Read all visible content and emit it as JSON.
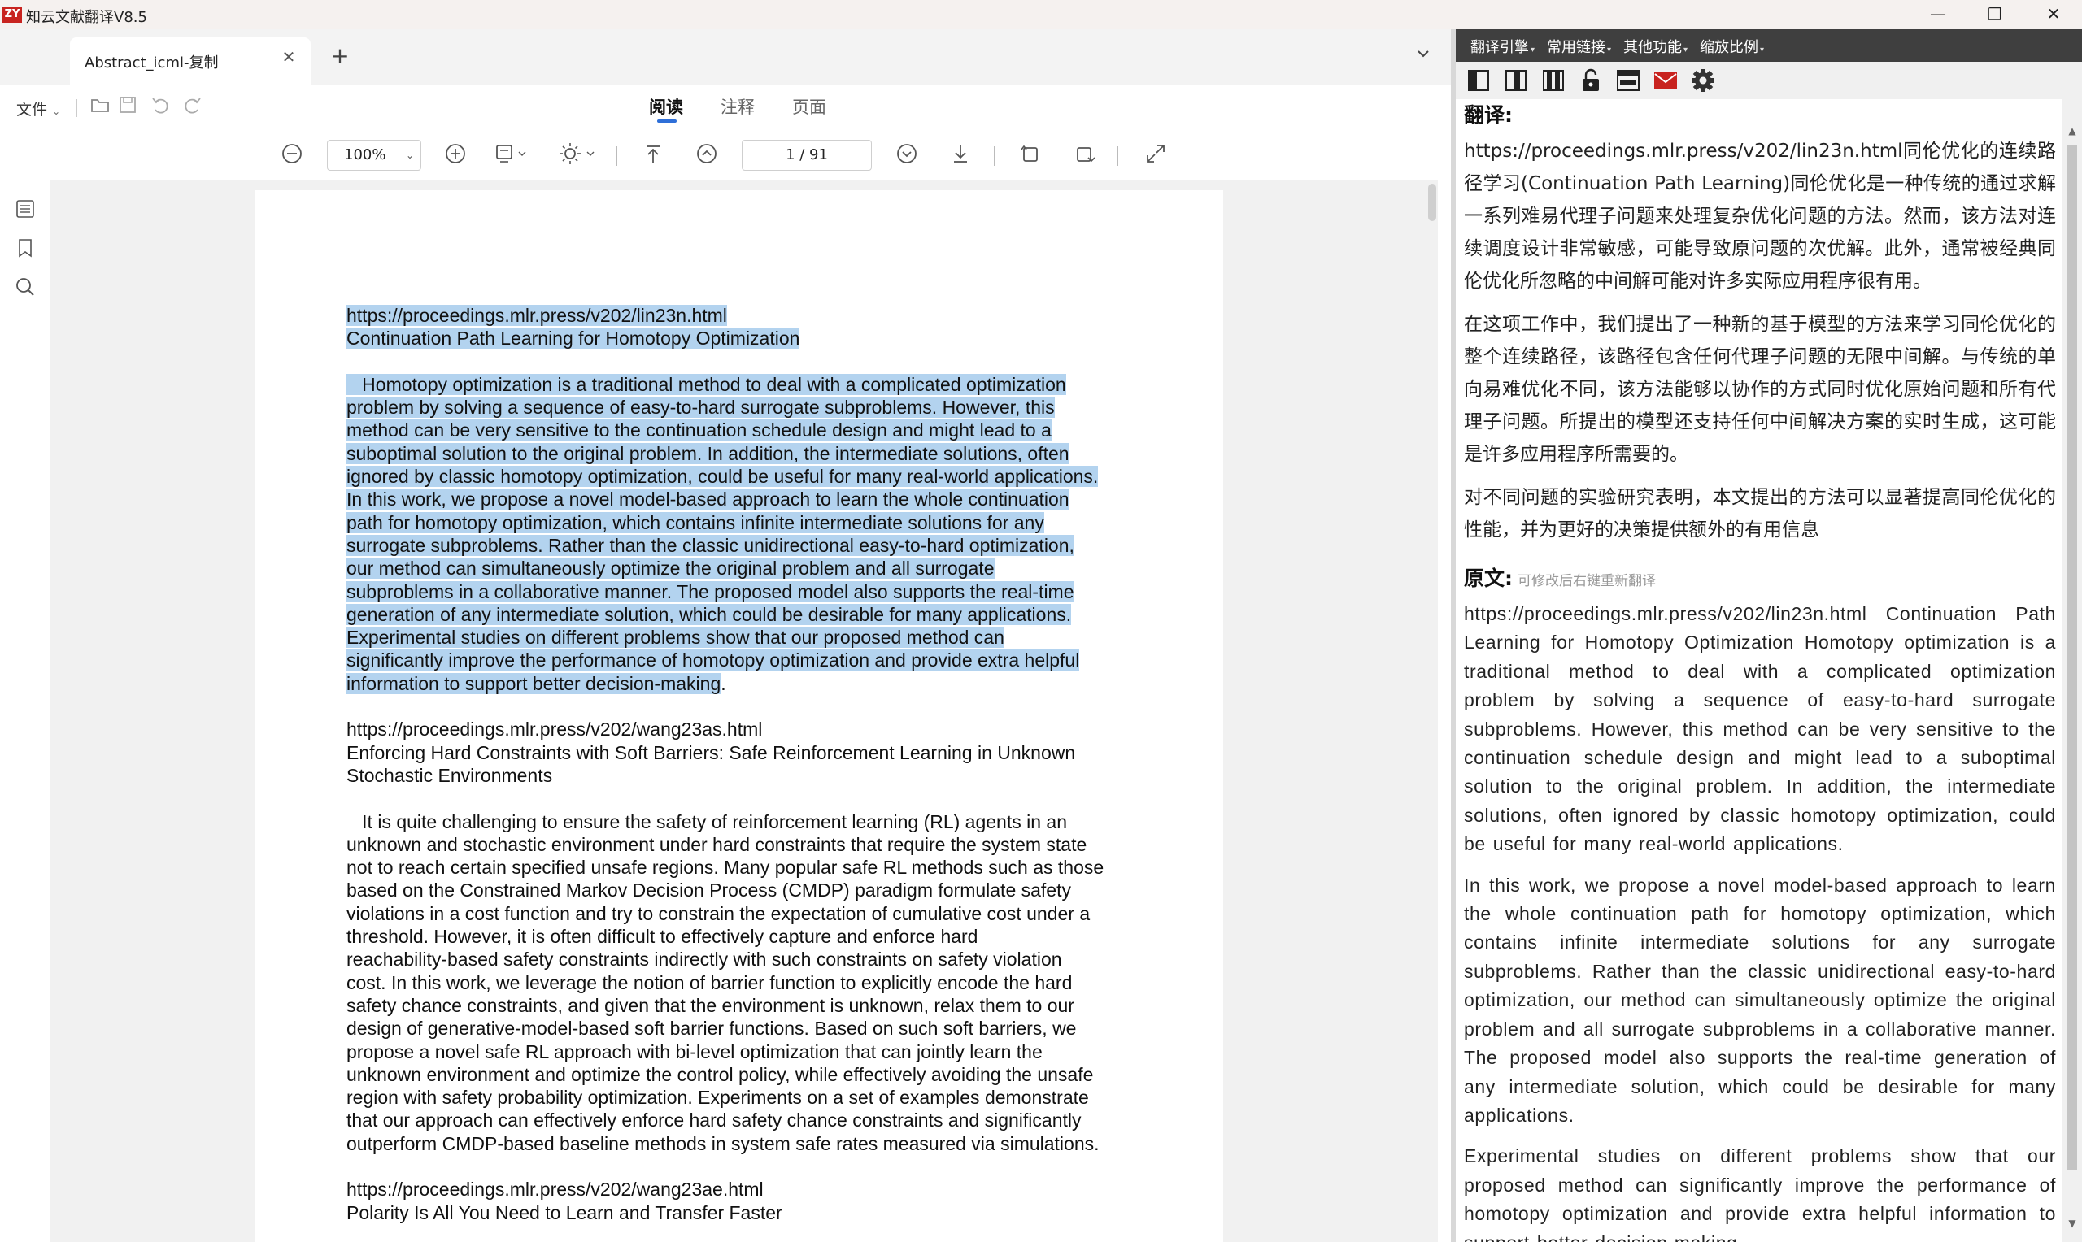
{
  "app": {
    "logo": "ZY",
    "title": "知云文献翻译V8.5",
    "minimize": "—",
    "maximize": "❐",
    "close": "✕"
  },
  "tabs": {
    "items": [
      {
        "label": "Abstract_icml-复制",
        "active": true
      }
    ],
    "new_tab": "+",
    "dropdown": "⌄"
  },
  "toolbar": {
    "file_menu": "文件",
    "modes": [
      "阅读",
      "注释",
      "页面"
    ],
    "active_mode": "阅读",
    "zoom": "100%",
    "page_indicator": "1 / 91"
  },
  "document": {
    "lines": [
      {
        "text": "https://proceedings.mlr.press/v202/lin23n.html",
        "highlighted": true
      },
      {
        "text": "Continuation Path Learning for Homotopy Optimization",
        "highlighted": true
      },
      {
        "text": "",
        "highlighted": false
      },
      {
        "text": "   Homotopy optimization is a traditional method to deal with a complicated optimization",
        "highlighted": true
      },
      {
        "text": "problem by solving a sequence of easy-to-hard surrogate subproblems. However, this",
        "highlighted": true
      },
      {
        "text": "method can be very sensitive to the continuation schedule design and might lead to a",
        "highlighted": true
      },
      {
        "text": "suboptimal solution to the original problem. In addition, the intermediate solutions, often",
        "highlighted": true
      },
      {
        "text": "ignored by classic homotopy optimization, could be useful for many real-world applications.",
        "highlighted": true
      },
      {
        "text": "In this work, we propose a novel model-based approach to learn the whole continuation",
        "highlighted": true
      },
      {
        "text": "path for homotopy optimization, which contains infinite intermediate solutions for any",
        "highlighted": true
      },
      {
        "text": "surrogate subproblems. Rather than the classic unidirectional easy-to-hard optimization,",
        "highlighted": true
      },
      {
        "text": "our method can simultaneously optimize the original problem and all surrogate",
        "highlighted": true
      },
      {
        "text": "subproblems in a collaborative manner. The proposed model also supports the real-time",
        "highlighted": true
      },
      {
        "text": "generation of any intermediate solution, which could be desirable for many applications.",
        "highlighted": true
      },
      {
        "text": "Experimental studies on different problems show that our proposed method can",
        "highlighted": true
      },
      {
        "text": "significantly improve the performance of homotopy optimization and provide extra helpful",
        "highlighted": true
      },
      {
        "text": "information to support better decision-making",
        "highlighted": true,
        "tail": "."
      },
      {
        "text": "",
        "highlighted": false
      },
      {
        "text": "https://proceedings.mlr.press/v202/wang23as.html",
        "highlighted": false
      },
      {
        "text": "Enforcing Hard Constraints with Soft Barriers: Safe Reinforcement Learning in Unknown",
        "highlighted": false
      },
      {
        "text": "Stochastic Environments",
        "highlighted": false
      },
      {
        "text": "",
        "highlighted": false
      },
      {
        "text": "   It is quite challenging to ensure the safety of reinforcement learning (RL) agents in an",
        "highlighted": false
      },
      {
        "text": "unknown and stochastic environment under hard constraints that require the system state",
        "highlighted": false
      },
      {
        "text": "not to reach certain specified unsafe regions. Many popular safe RL methods such as those",
        "highlighted": false
      },
      {
        "text": "based on the Constrained Markov Decision Process (CMDP) paradigm formulate safety",
        "highlighted": false
      },
      {
        "text": "violations in a cost function and try to constrain the expectation of cumulative cost under a",
        "highlighted": false
      },
      {
        "text": "threshold. However, it is often difficult to effectively capture and enforce hard",
        "highlighted": false
      },
      {
        "text": "reachability-based safety constraints indirectly with such constraints on safety violation",
        "highlighted": false
      },
      {
        "text": "cost. In this work, we leverage the notion of barrier function to explicitly encode the hard",
        "highlighted": false
      },
      {
        "text": "safety chance constraints, and given that the environment is unknown, relax them to our",
        "highlighted": false
      },
      {
        "text": "design of generative-model-based soft barrier functions. Based on such soft barriers, we",
        "highlighted": false
      },
      {
        "text": "propose a novel safe RL approach with bi-level optimization that can jointly learn the",
        "highlighted": false
      },
      {
        "text": "unknown environment and optimize the control policy, while effectively avoiding the unsafe",
        "highlighted": false
      },
      {
        "text": "region with safety probability optimization. Experiments on a set of examples demonstrate",
        "highlighted": false
      },
      {
        "text": "that our approach can effectively enforce hard safety chance constraints and significantly",
        "highlighted": false
      },
      {
        "text": "outperform CMDP-based baseline methods in system safe rates measured via simulations.",
        "highlighted": false
      },
      {
        "text": "",
        "highlighted": false
      },
      {
        "text": "https://proceedings.mlr.press/v202/wang23ae.html",
        "highlighted": false
      },
      {
        "text": "Polarity Is All You Need to Learn and Transfer Faster",
        "highlighted": false
      }
    ],
    "highlight_color": "#b3d3ef"
  },
  "panel": {
    "menu": [
      "翻译引擎",
      "常用链接",
      "其他功能",
      "缩放比例"
    ],
    "icons": [
      "layout-left-icon",
      "layout-center-icon",
      "layout-both-icon",
      "unlock-icon",
      "window-icon",
      "mail-icon",
      "settings-icon"
    ],
    "translation_heading": "翻译:",
    "translation_paragraphs": [
      "https://proceedings.mlr.press/v202/lin23n.html同伦优化的连续路径学习(Continuation Path Learning)同伦优化是一种传统的通过求解一系列难易代理子问题来处理复杂优化问题的方法。然而，该方法对连续调度设计非常敏感，可能导致原问题的次优解。此外，通常被经典同伦优化所忽略的中间解可能对许多实际应用程序很有用。",
      "在这项工作中，我们提出了一种新的基于模型的方法来学习同伦优化的整个连续路径，该路径包含任何代理子问题的无限中间解。与传统的单向易难优化不同，该方法能够以协作的方式同时优化原始问题和所有代理子问题。所提出的模型还支持任何中间解决方案的实时生成，这可能是许多应用程序所需要的。",
      "对不同问题的实验研究表明，本文提出的方法可以显著提高同伦优化的性能，并为更好的决策提供额外的有用信息"
    ],
    "original_heading": "原文:",
    "original_hint": "可修改后右键重新翻译",
    "original_paragraphs": [
      "https://proceedings.mlr.press/v202/lin23n.html Continuation Path Learning for Homotopy Optimization Homotopy optimization is a traditional method to deal with a complicated optimization problem by solving a sequence of easy-to-hard surrogate subproblems. However, this method can be very sensitive to the continuation schedule design and might lead to a suboptimal solution to the original problem. In addition, the intermediate solutions, often ignored by classic homotopy optimization, could be useful for many real-world applications.",
      "In this work, we propose a novel model-based approach to learn the whole continuation path for homotopy optimization, which contains infinite intermediate solutions for any surrogate subproblems. Rather than the classic unidirectional easy-to-hard optimization, our method can simultaneously optimize the original problem and all surrogate subproblems in a collaborative manner. The proposed model also supports the real-time generation of any intermediate solution, which could be desirable for many applications.",
      "Experimental studies on different problems show that our proposed method can significantly improve the performance of homotopy optimization and provide extra helpful information to support better decision-making."
    ]
  }
}
